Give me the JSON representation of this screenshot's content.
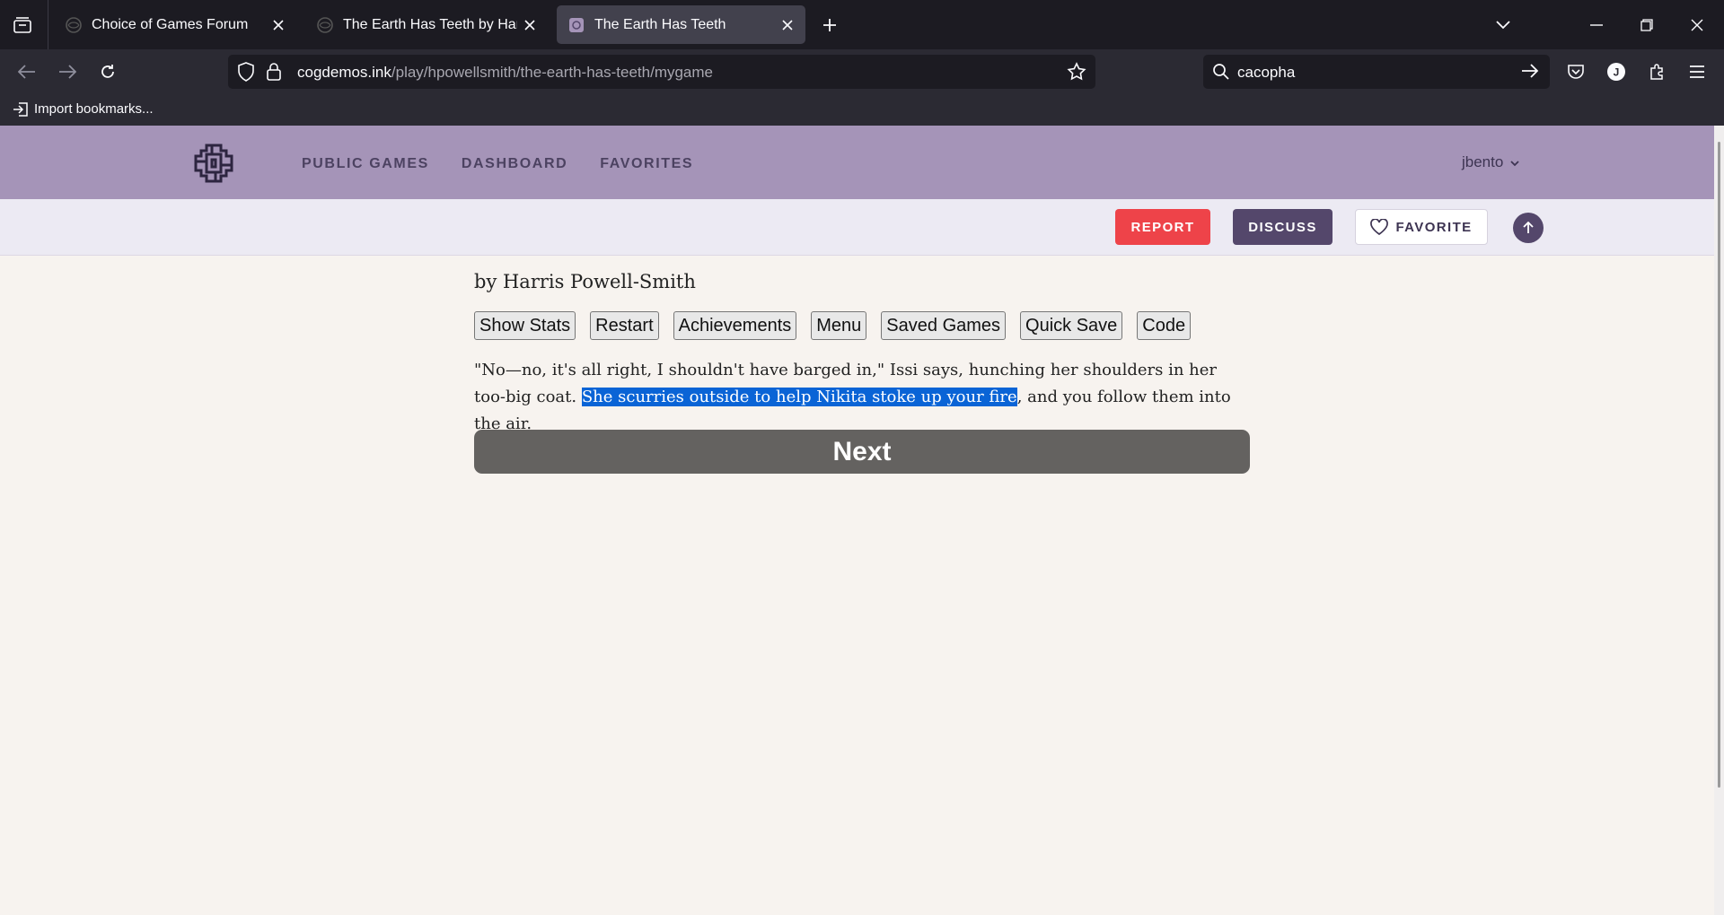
{
  "browser": {
    "tabs": [
      {
        "title": "Choice of Games Forum",
        "active": false
      },
      {
        "title": "The Earth Has Teeth by Harris Powell-Smith",
        "active": false
      },
      {
        "title": "The Earth Has Teeth",
        "active": true
      }
    ],
    "url": {
      "host": "cogdemos.ink",
      "path": "/play/hpowellsmith/the-earth-has-teeth/mygame"
    },
    "search_value": "cacopha",
    "bookmarks": {
      "import_label": "Import bookmarks..."
    },
    "profile_initial": "J"
  },
  "site": {
    "nav": [
      "PUBLIC GAMES",
      "DASHBOARD",
      "FAVORITES"
    ],
    "username": "jbento",
    "actions": {
      "report": "REPORT",
      "discuss": "DISCUSS",
      "favorite": "FAVORITE"
    }
  },
  "game": {
    "byline": "by Harris Powell-Smith",
    "buttons": [
      "Show Stats",
      "Restart",
      "Achievements",
      "Menu",
      "Saved Games",
      "Quick Save",
      "Code"
    ],
    "passage": {
      "before": "\"No—no, it's all right, I shouldn't have barged in,\" Issi says, hunching her shoulders in her too-big coat. ",
      "highlighted": "She scurries outside to help Nikita stoke up your fire",
      "after": ", and you follow them into the air."
    },
    "next_label": "Next"
  },
  "colors": {
    "header_bg": "#a594b8",
    "report": "#ee4349",
    "discuss": "#54476b",
    "next_bg": "#646260",
    "selection": "#0a64d6"
  }
}
